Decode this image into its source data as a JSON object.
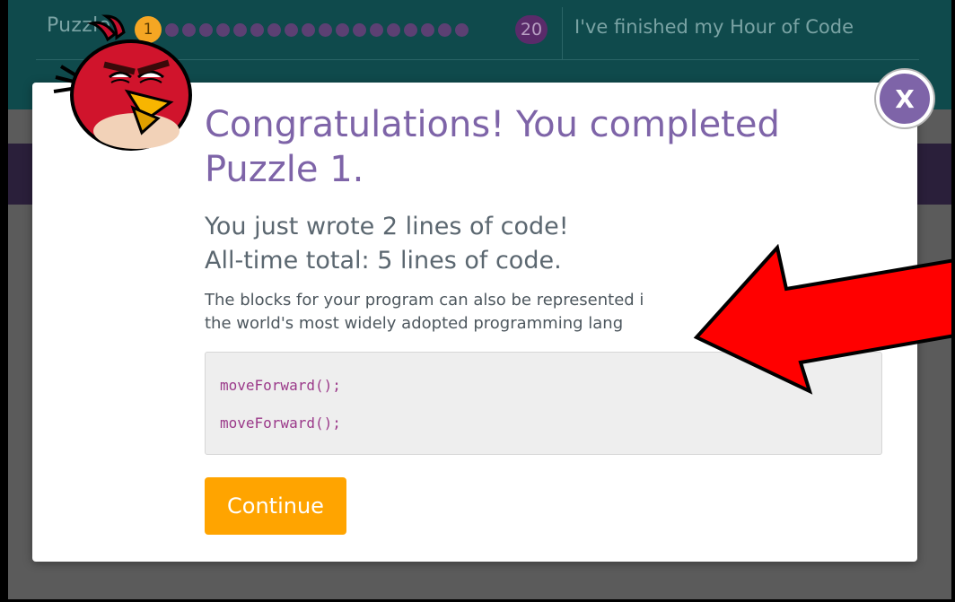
{
  "header": {
    "puzzle_label": "Puzzle",
    "current_puzzle": "1",
    "last_puzzle": "20",
    "finished_link": "I've finished my Hour of Code",
    "dot_count": 18
  },
  "dialog": {
    "title": "Congratulations! You completed Puzzle 1.",
    "summary_line1": "You just wrote 2 lines of code!",
    "summary_line2": "All-time total: 5 lines of code.",
    "explain_line1": "The blocks for your program can also be represented i",
    "explain_line2": "the world's most widely adopted programming lang",
    "code_lines": [
      "moveForward();",
      "moveForward();"
    ],
    "continue_label": "Continue",
    "close_label": "X"
  },
  "icons": {
    "bird": "red-bird-icon",
    "close": "close-icon",
    "arrow": "red-arrow-annotation"
  },
  "colors": {
    "header_bg": "#0f4a4c",
    "title": "#7e64a8",
    "continue": "#ffa400",
    "close": "#7e64a8",
    "code_text": "#9b3a8a",
    "arrow": "#ff0000"
  }
}
